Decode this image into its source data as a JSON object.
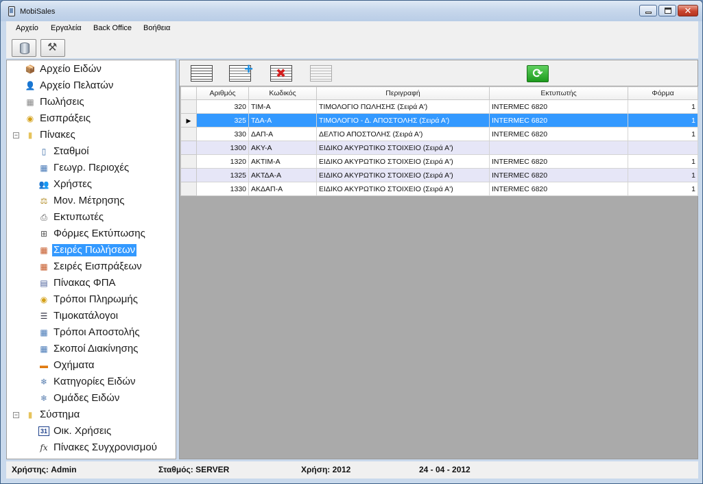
{
  "window": {
    "title": "MobiSales"
  },
  "menu": [
    "Αρχείο",
    "Εργαλεία",
    "Back Office",
    "Βοήθεια"
  ],
  "toolbar": {
    "buttons": [
      "database-icon",
      "tools-icon"
    ]
  },
  "tree": {
    "items": [
      {
        "label": "Αρχείο Ειδών",
        "icon": "box-icon",
        "level": 0
      },
      {
        "label": "Αρχείο Πελατών",
        "icon": "person-icon",
        "level": 0
      },
      {
        "label": "Πωλήσεις",
        "icon": "register-icon",
        "level": 0
      },
      {
        "label": "Εισπράξεις",
        "icon": "coins-icon",
        "level": 0
      },
      {
        "label": "Πίνακες",
        "icon": "folder-icon",
        "level": 0,
        "expander": "−"
      },
      {
        "label": "Σταθμοί",
        "icon": "device-icon",
        "level": 1
      },
      {
        "label": "Γεωγρ. Περιοχές",
        "icon": "table-icon",
        "level": 1
      },
      {
        "label": "Χρήστες",
        "icon": "users-icon",
        "level": 1
      },
      {
        "label": "Μον. Μέτρησης",
        "icon": "scale-icon",
        "level": 1
      },
      {
        "label": "Εκτυπωτές",
        "icon": "printer-icon",
        "level": 1
      },
      {
        "label": "Φόρμες Εκτύπωσης",
        "icon": "form-icon",
        "level": 1
      },
      {
        "label": "Σειρές Πωλήσεων",
        "icon": "table-color-icon",
        "level": 1,
        "selected": true
      },
      {
        "label": "Σειρές Εισπράξεων",
        "icon": "table-color-icon",
        "level": 1
      },
      {
        "label": "Πίνακας ΦΠΑ",
        "icon": "calculator-icon",
        "level": 1
      },
      {
        "label": "Τρόποι Πληρωμής",
        "icon": "coins-icon",
        "level": 1
      },
      {
        "label": "Τιμοκατάλογοι",
        "icon": "list-icon",
        "level": 1
      },
      {
        "label": "Τρόποι Αποστολής",
        "icon": "table-icon",
        "level": 1
      },
      {
        "label": "Σκοποί Διακίνησης",
        "icon": "table-icon",
        "level": 1
      },
      {
        "label": "Οχήματα",
        "icon": "truck-icon",
        "level": 1
      },
      {
        "label": "Κατηγορίες Ειδών",
        "icon": "snowflake-icon",
        "level": 1
      },
      {
        "label": "Ομάδες Ειδών",
        "icon": "snowflake-icon",
        "level": 1
      },
      {
        "label": "Σύστημα",
        "icon": "folder-icon",
        "level": 0,
        "expander": "−"
      },
      {
        "label": "Οικ. Χρήσεις",
        "icon": "calendar-icon",
        "level": 1,
        "glyph": "31"
      },
      {
        "label": "Πίνακες Συγχρονισμού",
        "icon": "function-icon",
        "level": 1,
        "glyph": "fx"
      }
    ]
  },
  "grid": {
    "columns": [
      "Αριθμός",
      "Κωδικός",
      "Περιγραφή",
      "Εκτυπωτής",
      "Φόρμα"
    ],
    "rows": [
      {
        "number": "320",
        "code": "ΤΙΜ-Α",
        "description": "ΤΙΜΟΛΟΓΙΟ ΠΩΛΗΣΗΣ (Σειρά Α')",
        "printer": "INTERMEC 6820",
        "form": "1"
      },
      {
        "number": "325",
        "code": "ΤΔΑ-Α",
        "description": "ΤΙΜΟΛΟΓΙΟ - Δ. ΑΠΟΣΤΟΛΗΣ (Σειρά Α')",
        "printer": "INTERMEC 6820",
        "form": "1",
        "selected": true
      },
      {
        "number": "330",
        "code": "ΔΑΠ-Α",
        "description": "ΔΕΛΤΙΟ ΑΠΟΣΤΟΛΗΣ (Σειρά Α')",
        "printer": "INTERMEC 6820",
        "form": "1"
      },
      {
        "number": "1300",
        "code": "ΑΚΥ-Α",
        "description": "ΕΙΔΙΚΟ ΑΚΥΡΩΤΙΚΟ ΣΤΟΙΧΕΙΟ (Σειρά Α')",
        "printer": "",
        "form": ""
      },
      {
        "number": "1320",
        "code": "ΑΚΤΙΜ-Α",
        "description": "ΕΙΔΙΚΟ ΑΚΥΡΩΤΙΚΟ ΣΤΟΙΧΕΙΟ (Σειρά Α')",
        "printer": "INTERMEC 6820",
        "form": "1"
      },
      {
        "number": "1325",
        "code": "ΑΚΤΔΑ-Α",
        "description": "ΕΙΔΙΚΟ ΑΚΥΡΩΤΙΚΟ ΣΤΟΙΧΕΙΟ (Σειρά Α')",
        "printer": "INTERMEC 6820",
        "form": "1"
      },
      {
        "number": "1330",
        "code": "ΑΚΔΑΠ-Α",
        "description": "ΕΙΔΙΚΟ ΑΚΥΡΩΤΙΚΟ ΣΤΟΙΧΕΙΟ (Σειρά Α')",
        "printer": "INTERMEC 6820",
        "form": "1"
      }
    ]
  },
  "status": {
    "user": "Χρήστης: Admin",
    "station": "Σταθμός: SERVER",
    "year": "Χρήση: 2012",
    "date": "24 - 04 - 2012"
  },
  "colors": {
    "selection": "#3399ff",
    "alt_row": "#e6e6f7",
    "grid_bg": "#aaaaaa"
  }
}
